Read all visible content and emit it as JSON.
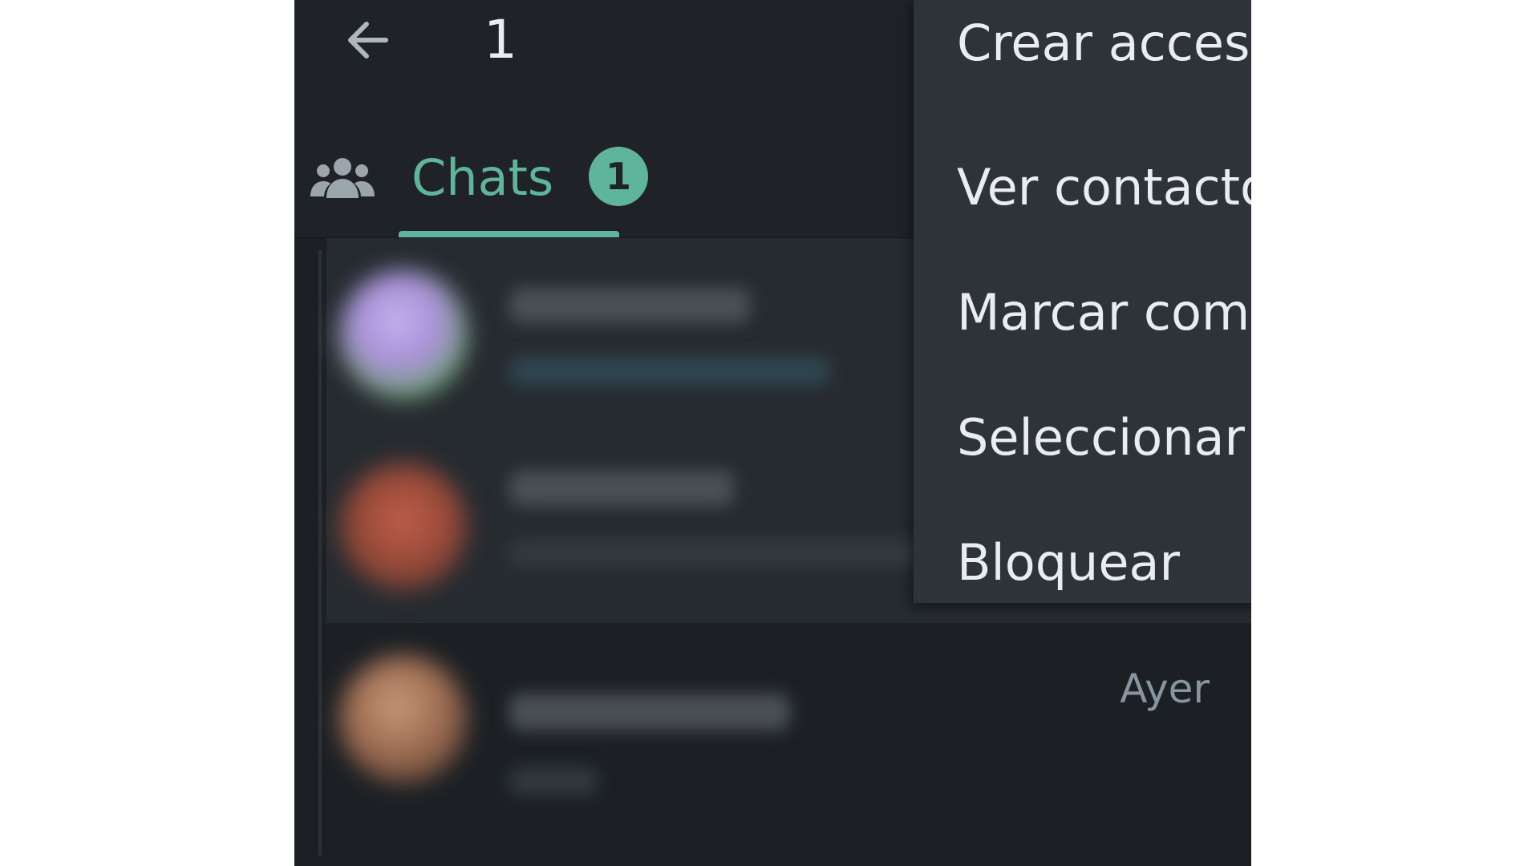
{
  "appbar": {
    "back_icon": "arrow-left-icon",
    "selected_count": "1"
  },
  "tabs": {
    "community_icon": "people-group-icon",
    "chats_label": "Chats",
    "chats_badge": "1",
    "accent": "#5fb59b"
  },
  "chat_list": {
    "rows": [
      {
        "time": ""
      },
      {
        "time": "",
        "muted": true,
        "unread": true
      },
      {
        "time": "Ayer"
      }
    ]
  },
  "context_menu": {
    "items": [
      {
        "label": "Crear acceso directo"
      },
      {
        "label": "Ver contacto"
      },
      {
        "label": "Marcar como no leído"
      },
      {
        "label": "Seleccionar todos"
      },
      {
        "label": "Bloquear"
      }
    ]
  }
}
